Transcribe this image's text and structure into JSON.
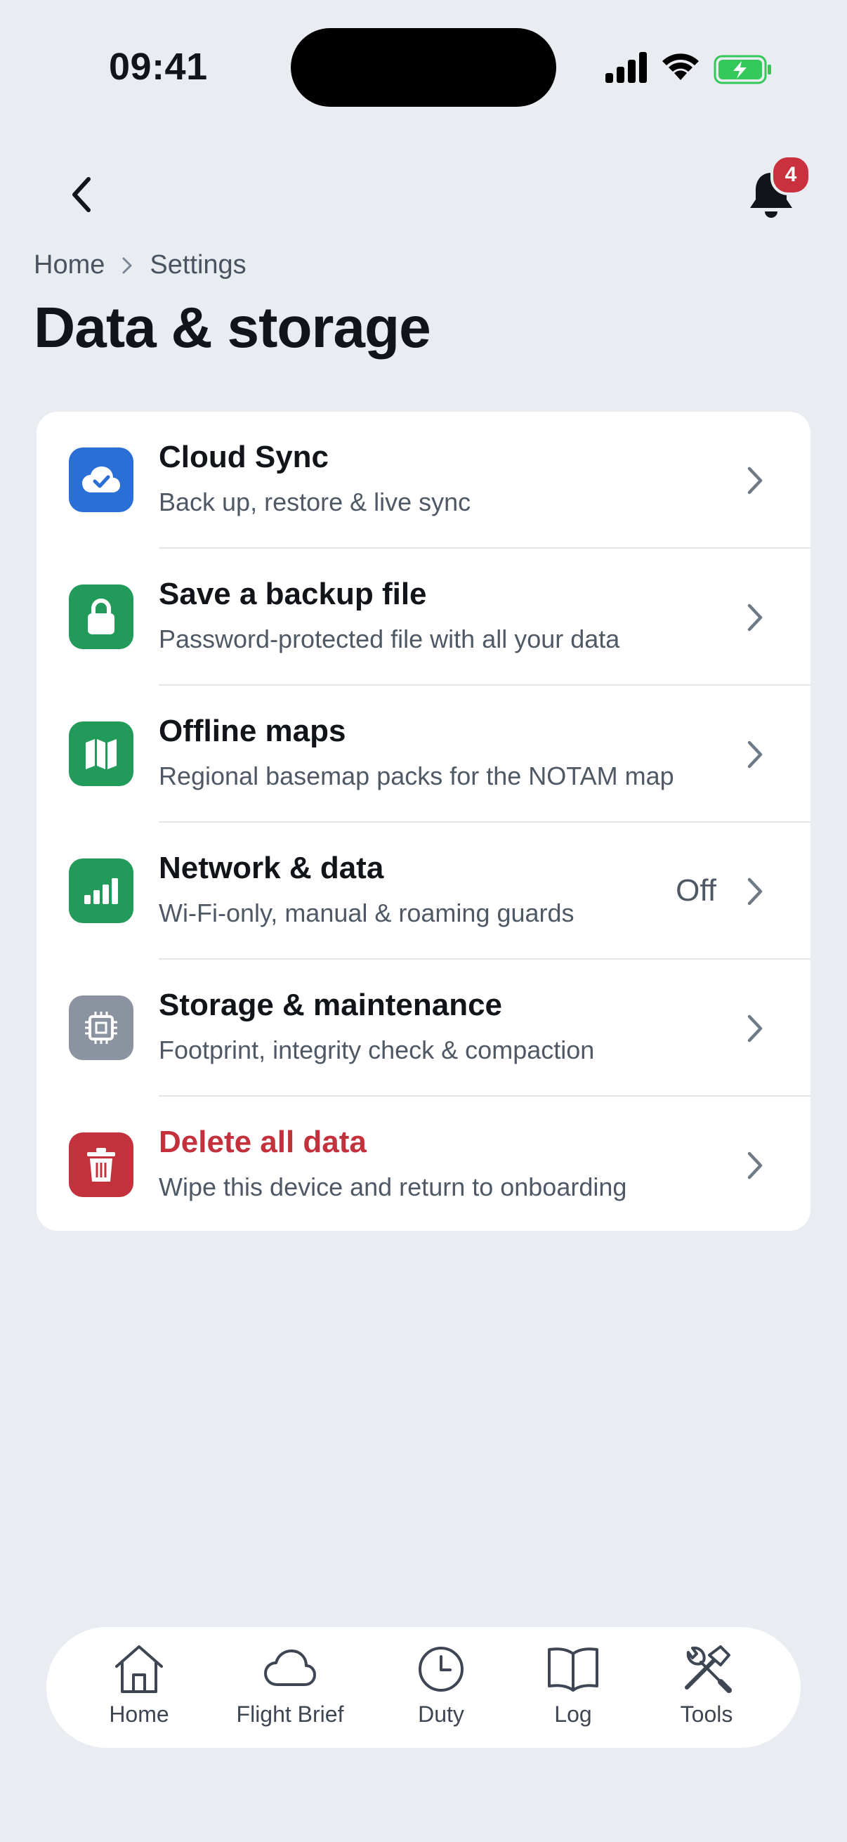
{
  "status_bar": {
    "time": "09:41"
  },
  "header": {
    "notification_count": "4"
  },
  "breadcrumb": {
    "home": "Home",
    "settings": "Settings"
  },
  "page": {
    "title": "Data & storage"
  },
  "settings_items": [
    {
      "title": "Cloud Sync",
      "subtitle": "Back up, restore & live sync",
      "icon": "cloud-check-icon",
      "icon_color": "#2a6fd6"
    },
    {
      "title": "Save a backup file",
      "subtitle": "Password-protected file with all your data",
      "icon": "lock-icon",
      "icon_color": "#229a5a"
    },
    {
      "title": "Offline maps",
      "subtitle": "Regional basemap packs for the NOTAM map",
      "icon": "map-icon",
      "icon_color": "#229a5a"
    },
    {
      "title": "Network & data",
      "subtitle": "Wi-Fi-only, manual & roaming guards",
      "value": "Off",
      "icon": "signal-bars-icon",
      "icon_color": "#229a5a"
    },
    {
      "title": "Storage & maintenance",
      "subtitle": "Footprint, integrity check & compaction",
      "icon": "chip-icon",
      "icon_color": "#8a939f"
    },
    {
      "title": "Delete all data",
      "subtitle": "Wipe this device and return to onboarding",
      "icon": "trash-icon",
      "icon_color": "#c3313c"
    }
  ],
  "tab_bar": [
    {
      "label": "Home",
      "icon": "home-icon"
    },
    {
      "label": "Flight Brief",
      "icon": "cloud-icon"
    },
    {
      "label": "Duty",
      "icon": "clock-icon"
    },
    {
      "label": "Log",
      "icon": "book-icon"
    },
    {
      "label": "Tools",
      "icon": "tools-icon"
    }
  ],
  "colors": {
    "background": "#e9ecf1",
    "danger": "#c3313c",
    "badge": "#c8313d",
    "battery": "#34c759"
  }
}
